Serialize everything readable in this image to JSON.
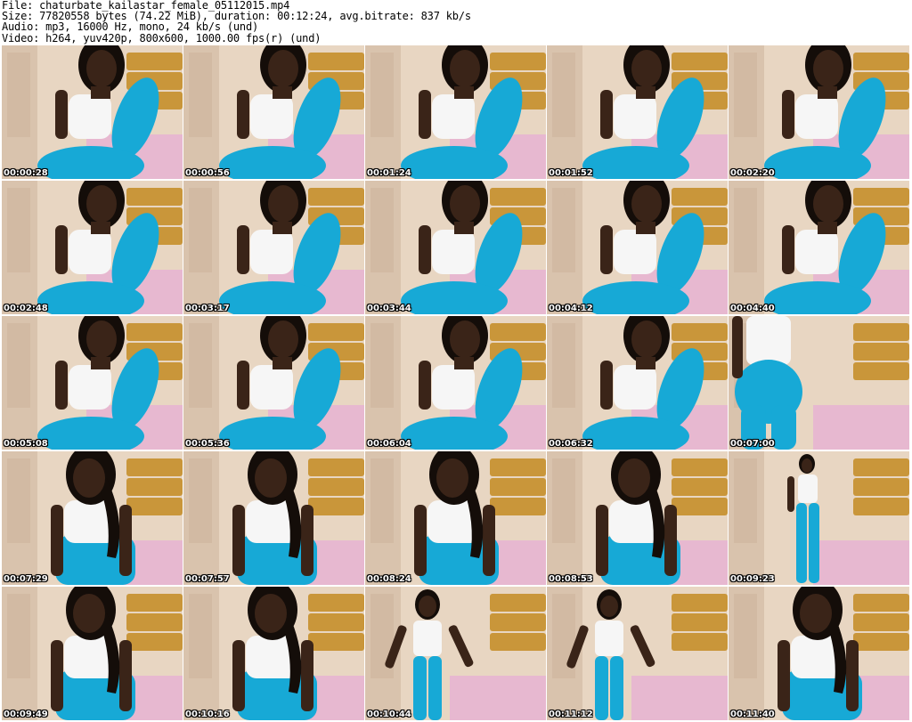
{
  "header": {
    "file_line": "File: chaturbate_kailastar_female_05112015.mp4",
    "size_line": "Size: 77820558 bytes (74.22 MiB), duration: 00:12:24, avg.bitrate: 837 kb/s",
    "audio_line": "Audio: mp3, 16000 Hz, mono, 24 kb/s (und)",
    "video_line": "Video: h264, yuv420p, 800x600, 1000.00 fps(r) (und)"
  },
  "colors": {
    "wall": "#e8d6c2",
    "door": "#d9c3ad",
    "headboard": "#c9963a",
    "bedding": "#e7b8d0",
    "skin": "#3a2418",
    "hair": "#140d09",
    "top": "#f6f6f6",
    "leggings": "#17a9d6"
  },
  "thumbnails": [
    {
      "time": "00:00:28",
      "scene": "sitting"
    },
    {
      "time": "00:00:56",
      "scene": "sitting"
    },
    {
      "time": "00:01:24",
      "scene": "sitting"
    },
    {
      "time": "00:01:52",
      "scene": "sitting"
    },
    {
      "time": "00:02:20",
      "scene": "sitting"
    },
    {
      "time": "00:02:48",
      "scene": "sitting"
    },
    {
      "time": "00:03:17",
      "scene": "sitting"
    },
    {
      "time": "00:03:44",
      "scene": "sitting"
    },
    {
      "time": "00:04:12",
      "scene": "sitting"
    },
    {
      "time": "00:04:40",
      "scene": "sitting"
    },
    {
      "time": "00:05:08",
      "scene": "sitting"
    },
    {
      "time": "00:05:36",
      "scene": "sitting"
    },
    {
      "time": "00:06:04",
      "scene": "sitting"
    },
    {
      "time": "00:06:32",
      "scene": "sitting"
    },
    {
      "time": "00:07:00",
      "scene": "standing-back"
    },
    {
      "time": "00:07:29",
      "scene": "leaning"
    },
    {
      "time": "00:07:57",
      "scene": "leaning"
    },
    {
      "time": "00:08:24",
      "scene": "leaning"
    },
    {
      "time": "00:08:53",
      "scene": "leaning"
    },
    {
      "time": "00:09:23",
      "scene": "standing-far"
    },
    {
      "time": "00:09:49",
      "scene": "leaning"
    },
    {
      "time": "00:10:16",
      "scene": "leaning"
    },
    {
      "time": "00:10:44",
      "scene": "standing"
    },
    {
      "time": "00:11:12",
      "scene": "standing"
    },
    {
      "time": "00:11:40",
      "scene": "leaning"
    }
  ]
}
